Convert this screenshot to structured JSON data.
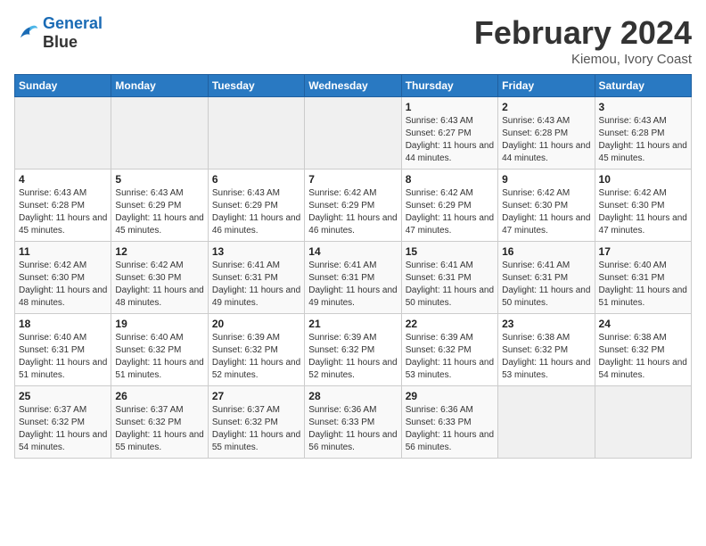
{
  "header": {
    "logo_line1": "General",
    "logo_line2": "Blue",
    "title": "February 2024",
    "subtitle": "Kiemou, Ivory Coast"
  },
  "weekdays": [
    "Sunday",
    "Monday",
    "Tuesday",
    "Wednesday",
    "Thursday",
    "Friday",
    "Saturday"
  ],
  "weeks": [
    [
      {
        "day": "",
        "info": ""
      },
      {
        "day": "",
        "info": ""
      },
      {
        "day": "",
        "info": ""
      },
      {
        "day": "",
        "info": ""
      },
      {
        "day": "1",
        "info": "Sunrise: 6:43 AM\nSunset: 6:27 PM\nDaylight: 11 hours and 44 minutes."
      },
      {
        "day": "2",
        "info": "Sunrise: 6:43 AM\nSunset: 6:28 PM\nDaylight: 11 hours and 44 minutes."
      },
      {
        "day": "3",
        "info": "Sunrise: 6:43 AM\nSunset: 6:28 PM\nDaylight: 11 hours and 45 minutes."
      }
    ],
    [
      {
        "day": "4",
        "info": "Sunrise: 6:43 AM\nSunset: 6:28 PM\nDaylight: 11 hours and 45 minutes."
      },
      {
        "day": "5",
        "info": "Sunrise: 6:43 AM\nSunset: 6:29 PM\nDaylight: 11 hours and 45 minutes."
      },
      {
        "day": "6",
        "info": "Sunrise: 6:43 AM\nSunset: 6:29 PM\nDaylight: 11 hours and 46 minutes."
      },
      {
        "day": "7",
        "info": "Sunrise: 6:42 AM\nSunset: 6:29 PM\nDaylight: 11 hours and 46 minutes."
      },
      {
        "day": "8",
        "info": "Sunrise: 6:42 AM\nSunset: 6:29 PM\nDaylight: 11 hours and 47 minutes."
      },
      {
        "day": "9",
        "info": "Sunrise: 6:42 AM\nSunset: 6:30 PM\nDaylight: 11 hours and 47 minutes."
      },
      {
        "day": "10",
        "info": "Sunrise: 6:42 AM\nSunset: 6:30 PM\nDaylight: 11 hours and 47 minutes."
      }
    ],
    [
      {
        "day": "11",
        "info": "Sunrise: 6:42 AM\nSunset: 6:30 PM\nDaylight: 11 hours and 48 minutes."
      },
      {
        "day": "12",
        "info": "Sunrise: 6:42 AM\nSunset: 6:30 PM\nDaylight: 11 hours and 48 minutes."
      },
      {
        "day": "13",
        "info": "Sunrise: 6:41 AM\nSunset: 6:31 PM\nDaylight: 11 hours and 49 minutes."
      },
      {
        "day": "14",
        "info": "Sunrise: 6:41 AM\nSunset: 6:31 PM\nDaylight: 11 hours and 49 minutes."
      },
      {
        "day": "15",
        "info": "Sunrise: 6:41 AM\nSunset: 6:31 PM\nDaylight: 11 hours and 50 minutes."
      },
      {
        "day": "16",
        "info": "Sunrise: 6:41 AM\nSunset: 6:31 PM\nDaylight: 11 hours and 50 minutes."
      },
      {
        "day": "17",
        "info": "Sunrise: 6:40 AM\nSunset: 6:31 PM\nDaylight: 11 hours and 51 minutes."
      }
    ],
    [
      {
        "day": "18",
        "info": "Sunrise: 6:40 AM\nSunset: 6:31 PM\nDaylight: 11 hours and 51 minutes."
      },
      {
        "day": "19",
        "info": "Sunrise: 6:40 AM\nSunset: 6:32 PM\nDaylight: 11 hours and 51 minutes."
      },
      {
        "day": "20",
        "info": "Sunrise: 6:39 AM\nSunset: 6:32 PM\nDaylight: 11 hours and 52 minutes."
      },
      {
        "day": "21",
        "info": "Sunrise: 6:39 AM\nSunset: 6:32 PM\nDaylight: 11 hours and 52 minutes."
      },
      {
        "day": "22",
        "info": "Sunrise: 6:39 AM\nSunset: 6:32 PM\nDaylight: 11 hours and 53 minutes."
      },
      {
        "day": "23",
        "info": "Sunrise: 6:38 AM\nSunset: 6:32 PM\nDaylight: 11 hours and 53 minutes."
      },
      {
        "day": "24",
        "info": "Sunrise: 6:38 AM\nSunset: 6:32 PM\nDaylight: 11 hours and 54 minutes."
      }
    ],
    [
      {
        "day": "25",
        "info": "Sunrise: 6:37 AM\nSunset: 6:32 PM\nDaylight: 11 hours and 54 minutes."
      },
      {
        "day": "26",
        "info": "Sunrise: 6:37 AM\nSunset: 6:32 PM\nDaylight: 11 hours and 55 minutes."
      },
      {
        "day": "27",
        "info": "Sunrise: 6:37 AM\nSunset: 6:32 PM\nDaylight: 11 hours and 55 minutes."
      },
      {
        "day": "28",
        "info": "Sunrise: 6:36 AM\nSunset: 6:33 PM\nDaylight: 11 hours and 56 minutes."
      },
      {
        "day": "29",
        "info": "Sunrise: 6:36 AM\nSunset: 6:33 PM\nDaylight: 11 hours and 56 minutes."
      },
      {
        "day": "",
        "info": ""
      },
      {
        "day": "",
        "info": ""
      }
    ]
  ]
}
